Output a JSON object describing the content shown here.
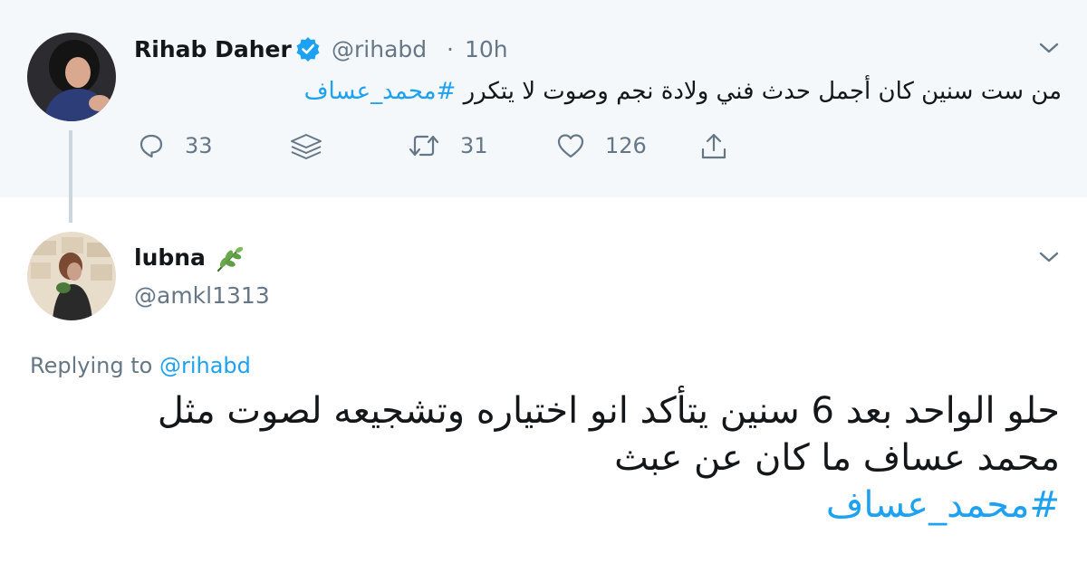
{
  "parent_tweet": {
    "name": "Rihab Daher",
    "handle": "@rihabd",
    "separator": "·",
    "time": "10h",
    "text_prefix": "من ست سنين كان أجمل حدث فني ولادة نجم وصوت لا يتكرر",
    "hashtag": "#محمد_عساف",
    "counts": {
      "replies": "33",
      "retweets": "31",
      "likes": "126"
    }
  },
  "reply_tweet": {
    "name": "lubna",
    "handle": "@amkl1313",
    "replying_prefix": "Replying to",
    "replying_mention": "@rihabd",
    "body_line1": "حلو الواحد بعد 6 سنين يتأكد انو اختياره وتشجيعه لصوت مثل",
    "body_line2": "محمد عساف ما كان عن عبث",
    "hashtag": "#محمد_عساف"
  },
  "colors": {
    "accent": "#1da1f2",
    "muted": "#657786",
    "parent_background": "#f5f8fa",
    "thread_line": "#ccd6dd"
  },
  "icons": [
    "verified-badge-icon",
    "chevron-down-icon",
    "reply-icon",
    "layers-icon",
    "retweet-icon",
    "heart-icon",
    "share-icon",
    "herb-emoji-icon"
  ]
}
